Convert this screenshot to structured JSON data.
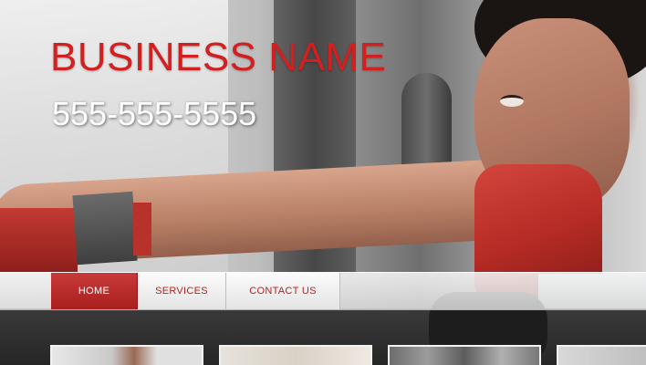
{
  "header": {
    "business_name": "BUSINESS NAME",
    "phone": "555-555-5555"
  },
  "nav": {
    "items": [
      {
        "label": "HOME",
        "active": true
      },
      {
        "label": "SERVICES",
        "active": false
      },
      {
        "label": "CONTACT US",
        "active": false
      }
    ]
  },
  "colors": {
    "accent": "#b5231f",
    "active_tab": "#c73a39",
    "nav_bg": "#e6e6e6"
  }
}
